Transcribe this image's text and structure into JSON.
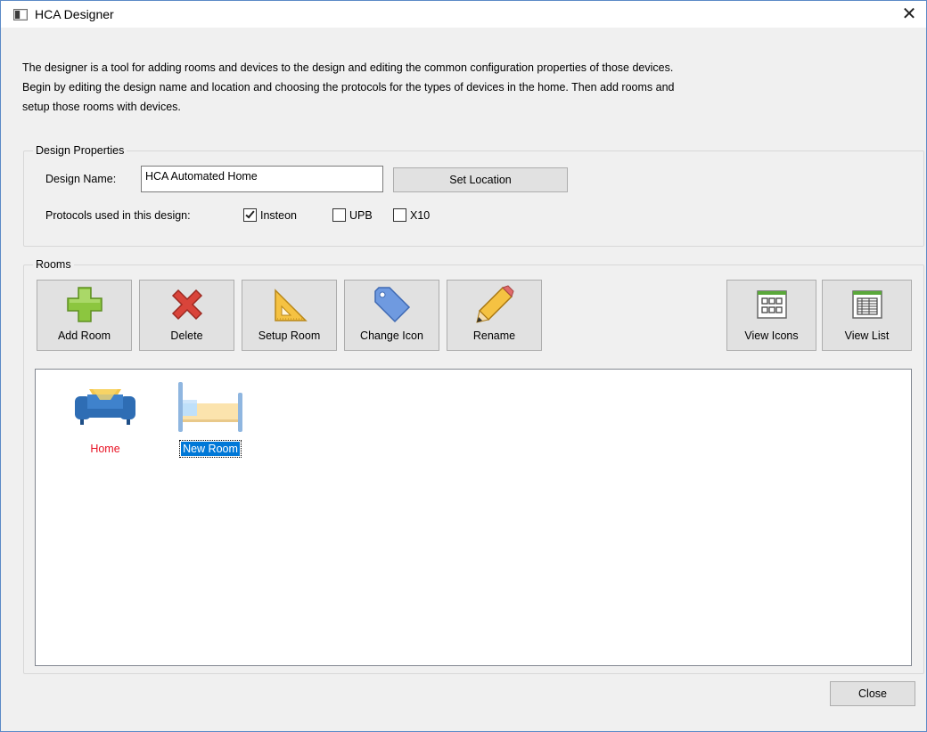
{
  "window": {
    "title": "HCA Designer",
    "close_glyph": "✕"
  },
  "intro": {
    "line1": "The designer is a tool for adding rooms and devices to the design and editing the common configuration properties of those devices.",
    "line2": "Begin by editing the design name and location and choosing the protocols for the types of devices in the home. Then add rooms and",
    "line3": "setup those rooms with devices."
  },
  "design_properties": {
    "legend": "Design Properties",
    "name_label": "Design Name:",
    "name_value": "HCA Automated Home",
    "set_location_label": "Set Location",
    "protocols_label": "Protocols used in this design:",
    "protocols": [
      {
        "label": "Insteon",
        "checked": true
      },
      {
        "label": "UPB",
        "checked": false
      },
      {
        "label": "X10",
        "checked": false
      }
    ]
  },
  "rooms": {
    "legend": "Rooms",
    "toolbar": {
      "add_room": "Add Room",
      "delete": "Delete",
      "setup_room": "Setup Room",
      "change_icon": "Change Icon",
      "rename": "Rename",
      "view_icons": "View Icons",
      "view_list": "View List"
    },
    "items": [
      {
        "label": "Home",
        "icon": "sofa-icon",
        "color": "#e81123"
      },
      {
        "label": "New Room",
        "icon": "bed-icon",
        "selected": true
      }
    ]
  },
  "footer": {
    "close_label": "Close"
  },
  "colors": {
    "accent": "#0078d7",
    "home_label": "#e81123",
    "window_border": "#5b8ac7"
  }
}
